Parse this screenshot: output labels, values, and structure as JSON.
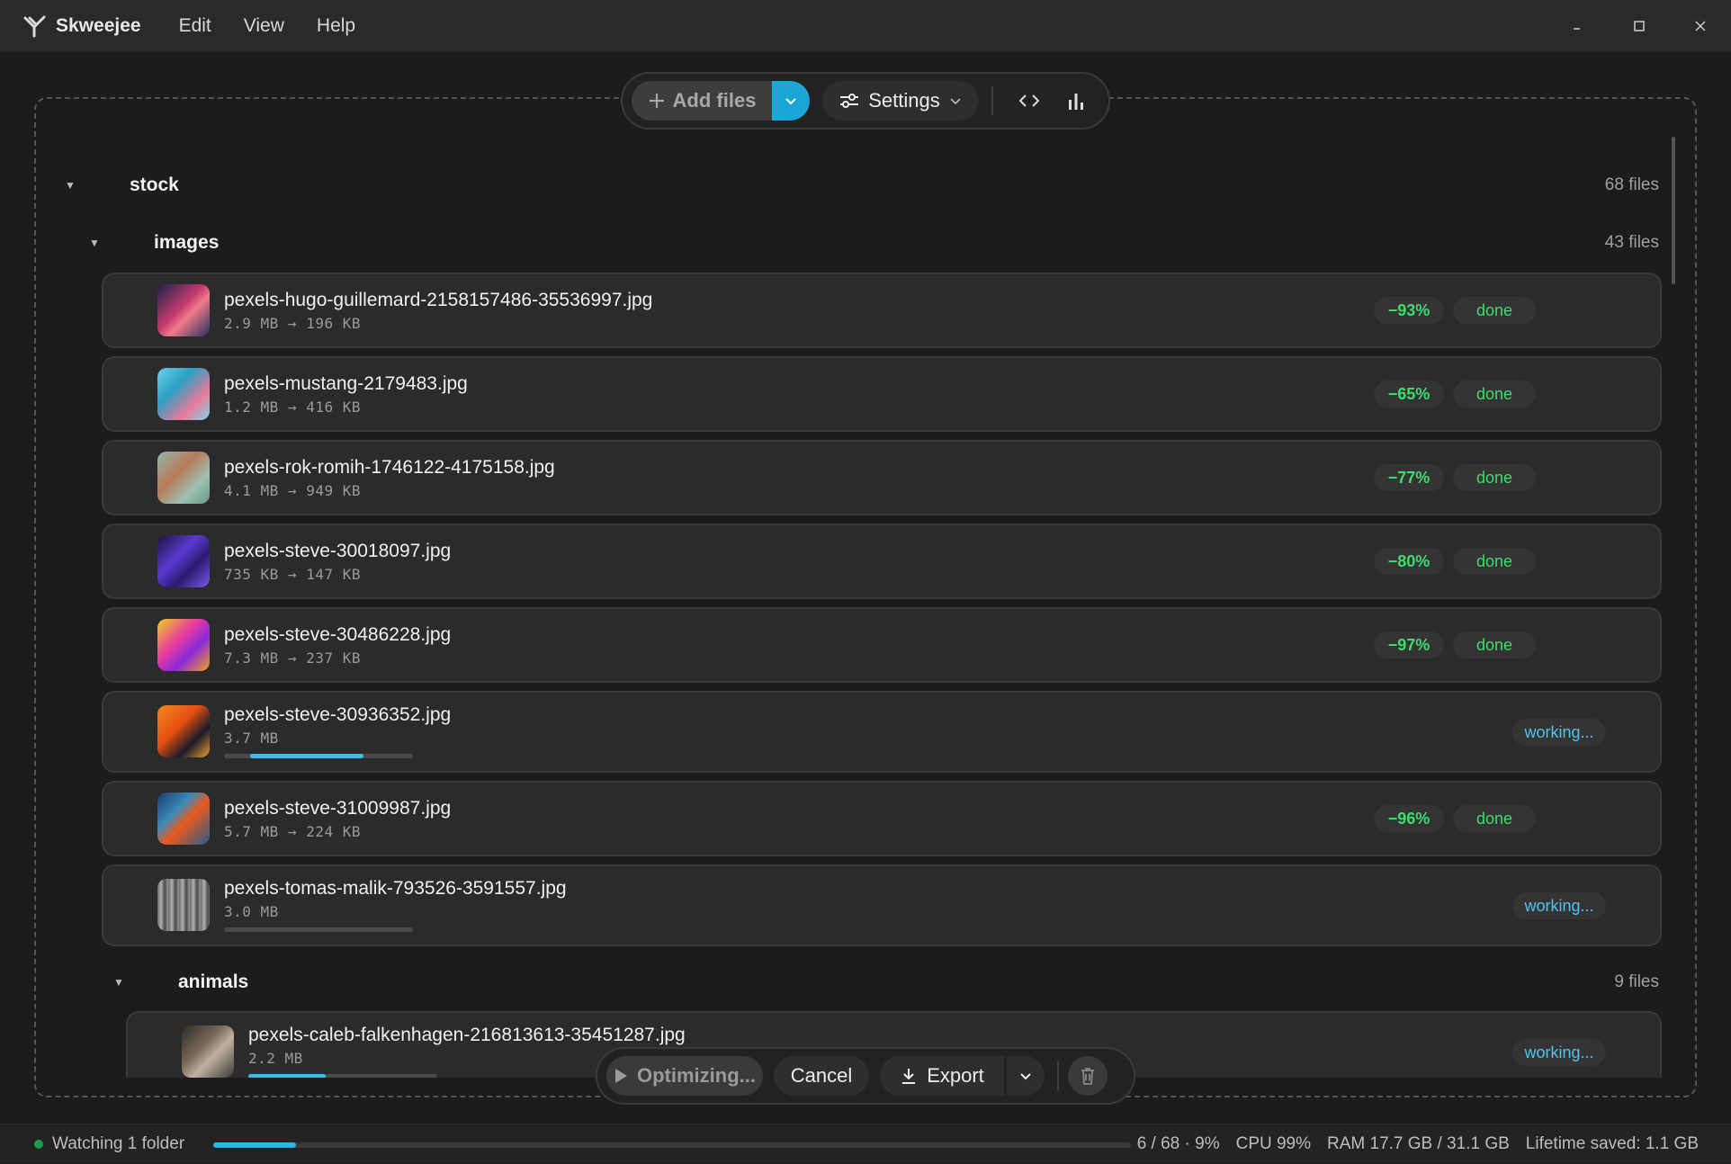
{
  "app": {
    "name": "Skweejee"
  },
  "menu": [
    "Edit",
    "View",
    "Help"
  ],
  "toolbar": {
    "add_files": "Add files",
    "settings": "Settings"
  },
  "folders": {
    "stock": {
      "name": "stock",
      "count": "68 files"
    },
    "images": {
      "name": "images",
      "count": "43 files"
    },
    "animals": {
      "name": "animals",
      "count": "9 files"
    }
  },
  "files": [
    {
      "name": "pexels-hugo-guillemard-2158157486-35536997.jpg",
      "size": "2.9 MB → 196 KB",
      "pct": "−93%",
      "status": "done"
    },
    {
      "name": "pexels-mustang-2179483.jpg",
      "size": "1.2 MB → 416 KB",
      "pct": "−65%",
      "status": "done"
    },
    {
      "name": "pexels-rok-romih-1746122-4175158.jpg",
      "size": "4.1 MB → 949 KB",
      "pct": "−77%",
      "status": "done"
    },
    {
      "name": "pexels-steve-30018097.jpg",
      "size": "735 KB → 147 KB",
      "pct": "−80%",
      "status": "done"
    },
    {
      "name": "pexels-steve-30486228.jpg",
      "size": "7.3 MB → 237 KB",
      "pct": "−97%",
      "status": "done"
    },
    {
      "name": "pexels-steve-30936352.jpg",
      "size": "3.7 MB",
      "status": "working...",
      "progress_fill": [
        0.14,
        0.74
      ]
    },
    {
      "name": "pexels-steve-31009987.jpg",
      "size": "5.7 MB → 224 KB",
      "pct": "−96%",
      "status": "done"
    },
    {
      "name": "pexels-tomas-malik-793526-3591557.jpg",
      "size": "3.0 MB",
      "status": "working...",
      "progress_fill": [
        0,
        0
      ]
    },
    {
      "name": "pexels-caleb-falkenhagen-216813613-35451287.jpg",
      "size": "2.2 MB",
      "status": "working...",
      "progress_fill": [
        0,
        0.41
      ]
    }
  ],
  "actions": {
    "optimize": "Optimizing...",
    "cancel": "Cancel",
    "export": "Export"
  },
  "status": {
    "watching": "Watching 1 folder",
    "progress": "6 / 68 · 9%",
    "progress_value": 0.09,
    "cpu": "CPU 99%",
    "ram": "RAM 17.7 GB / 31.1 GB",
    "lifetime": "Lifetime saved: 1.1 GB"
  },
  "colors": {
    "accent": "#1aa7d8",
    "success": "#3ddc6e",
    "working": "#4fc3ee"
  }
}
